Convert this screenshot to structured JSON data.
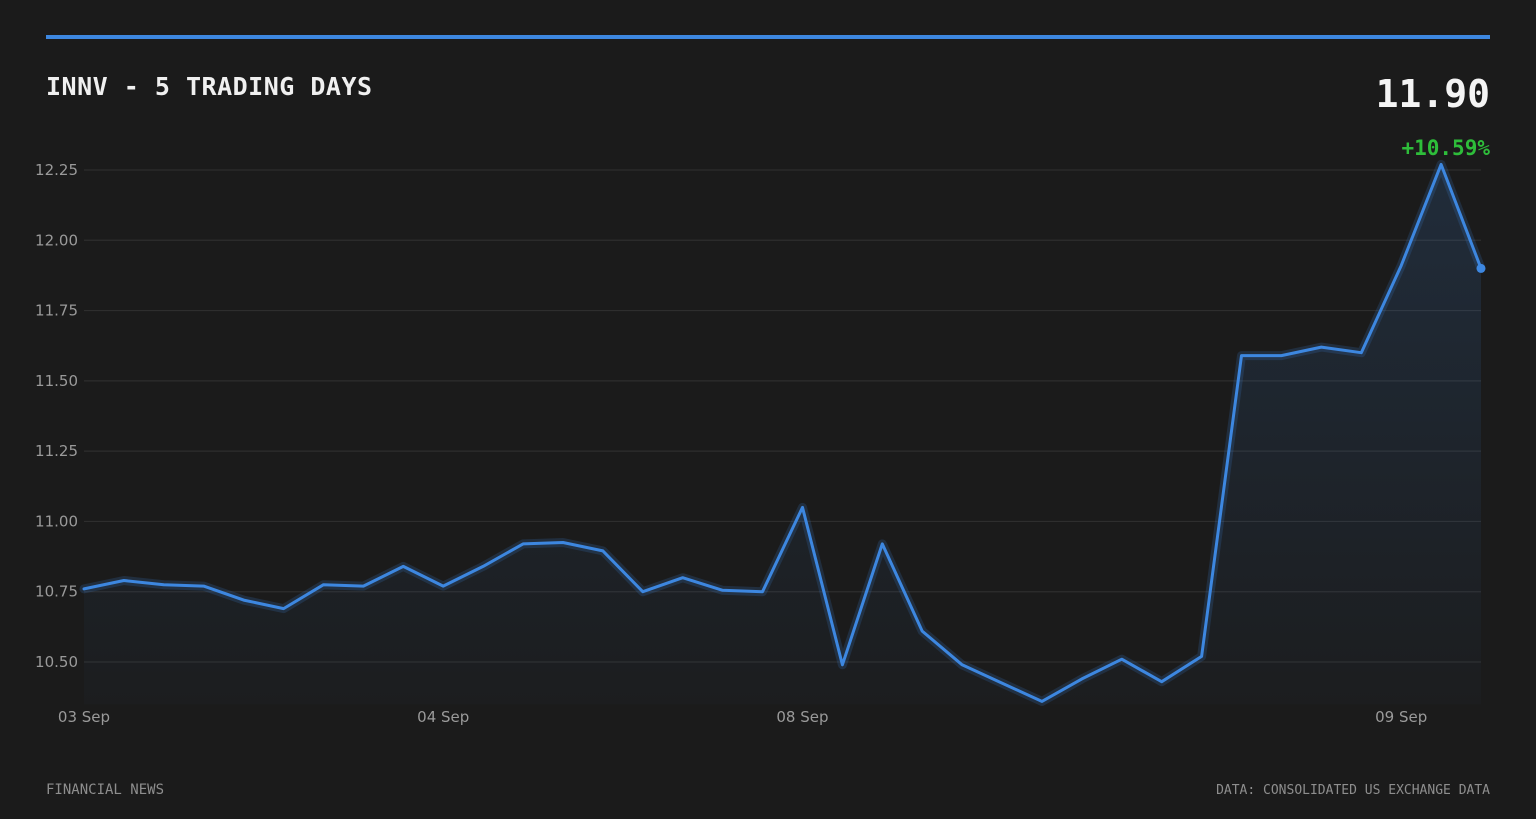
{
  "header": {
    "title": "INNV - 5 TRADING DAYS",
    "last_price": "11.90",
    "change_pct": "+10.59%"
  },
  "footer": {
    "source_left": "FINANCIAL NEWS",
    "source_right": "DATA: CONSOLIDATED US EXCHANGE DATA"
  },
  "colors": {
    "background": "#1b1b1b",
    "accent": "#3d87e0",
    "positive": "#2ebd3a",
    "gridline": "#2e2e2e"
  },
  "chart_data": {
    "type": "area",
    "title": "INNV - 5 TRADING DAYS",
    "xlabel": "",
    "ylabel": "",
    "ylim": [
      10.35,
      12.28
    ],
    "yticks": [
      10.5,
      10.75,
      11.0,
      11.25,
      11.5,
      11.75,
      12.0,
      12.25
    ],
    "ytick_labels": [
      "10.50",
      "10.75",
      "11.00",
      "11.25",
      "11.50",
      "11.75",
      "12.00",
      "12.25"
    ],
    "xticks": [
      {
        "index": 0,
        "label": "03 Sep"
      },
      {
        "index": 9,
        "label": "04 Sep"
      },
      {
        "index": 18,
        "label": "08 Sep"
      },
      {
        "index": 33,
        "label": "09 Sep"
      }
    ],
    "grid": true,
    "legend": "none",
    "series": [
      {
        "values": [
          10.76,
          10.79,
          10.775,
          10.77,
          10.72,
          10.69,
          10.775,
          10.77,
          10.84,
          10.77,
          10.84,
          10.92,
          10.925,
          10.895,
          10.75,
          10.8,
          10.755,
          10.75,
          11.05,
          10.49,
          10.92,
          10.61,
          10.49,
          10.425,
          10.36,
          10.44,
          10.51,
          10.43,
          10.52,
          11.59,
          11.59,
          11.62,
          11.6,
          11.91,
          12.27,
          11.9
        ]
      }
    ]
  }
}
